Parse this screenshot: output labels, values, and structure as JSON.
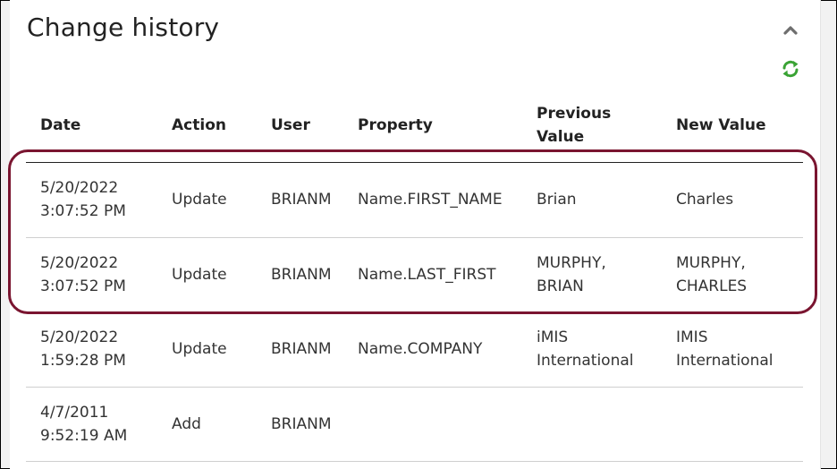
{
  "panel": {
    "title": "Change history"
  },
  "icons": {
    "collapse": "chevron-up-icon",
    "refresh": "refresh-icon"
  },
  "colors": {
    "highlight": "#7a1530",
    "refresh_green": "#3aa335"
  },
  "table": {
    "headers": {
      "date": "Date",
      "action": "Action",
      "user": "User",
      "property": "Property",
      "previous_line1": "Previous",
      "previous_line2": "Value",
      "new_value": "New Value"
    },
    "rows": [
      {
        "date1": "5/20/2022",
        "date2": "3:07:52 PM",
        "action": "Update",
        "user": "BRIANM",
        "property": "Name.FIRST_NAME",
        "prev1": "Brian",
        "prev2": "",
        "new1": "Charles",
        "new2": ""
      },
      {
        "date1": "5/20/2022",
        "date2": "3:07:52 PM",
        "action": "Update",
        "user": "BRIANM",
        "property": "Name.LAST_FIRST",
        "prev1": "MURPHY,",
        "prev2": "BRIAN",
        "new1": "MURPHY,",
        "new2": "CHARLES"
      },
      {
        "date1": "5/20/2022",
        "date2": "1:59:28 PM",
        "action": "Update",
        "user": "BRIANM",
        "property": "Name.COMPANY",
        "prev1": "iMIS",
        "prev2": "International",
        "new1": "IMIS",
        "new2": "International"
      },
      {
        "date1": "4/7/2011",
        "date2": "9:52:19 AM",
        "action": "Add",
        "user": "BRIANM",
        "property": "",
        "prev1": "",
        "prev2": "",
        "new1": "",
        "new2": ""
      }
    ]
  }
}
